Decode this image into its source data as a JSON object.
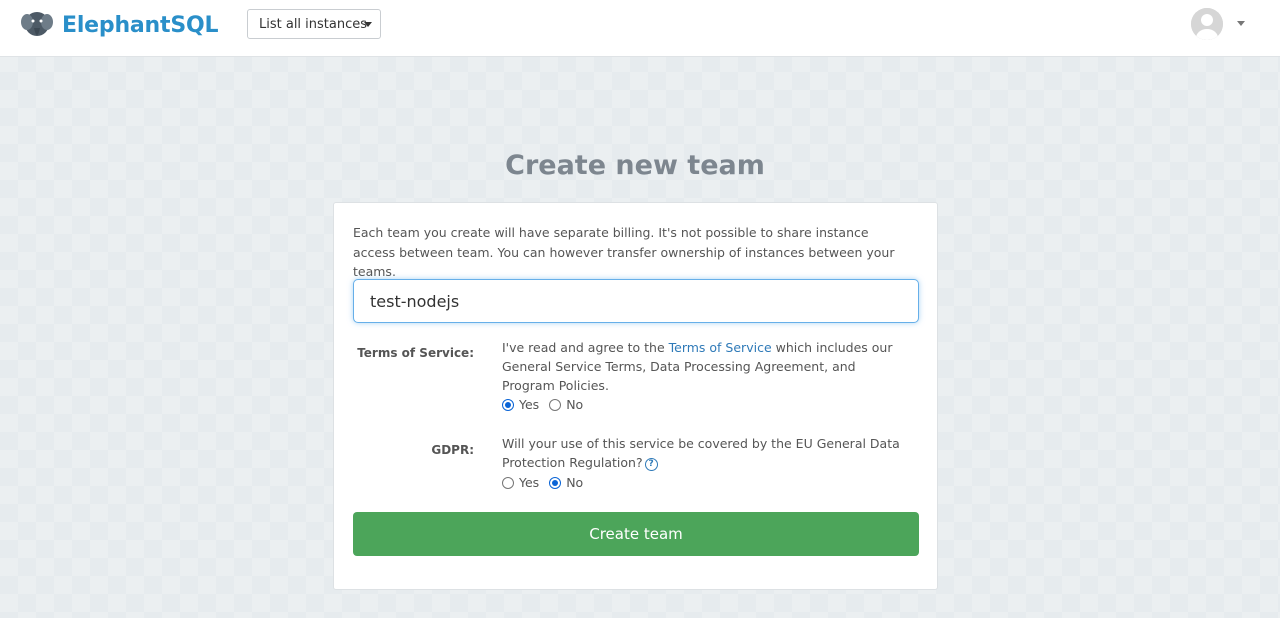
{
  "header": {
    "brand_name": "ElephantSQL",
    "logo_icon": "elephant-logo-icon",
    "instances_dropdown": "List all instances",
    "avatar_icon": "user-avatar-icon"
  },
  "main": {
    "title": "Create new team",
    "intro": "Each team you create will have separate billing. It's not possible to share instance access between team. You can however transfer ownership of instances between your teams.",
    "team_name_value": "test-nodejs",
    "tos": {
      "label": "Terms of Service:",
      "text_before": "I've read and agree to the ",
      "link": "Terms of Service",
      "text_after": " which includes our General Service Terms, Data Processing Agreement, and Program Policies.",
      "yes": "Yes",
      "no": "No",
      "selected": "Yes"
    },
    "gdpr": {
      "label": "GDPR:",
      "text": "Will your use of this service be covered by the EU General Data Protection Regulation?",
      "help_icon": "question-circle-icon",
      "yes": "Yes",
      "no": "No",
      "selected": "No"
    },
    "create_button": "Create team"
  },
  "colors": {
    "brand": "#2a8fc9",
    "link": "#2f7ab8",
    "button": "#4ca55a",
    "radio_selected": "#0a64d6"
  }
}
